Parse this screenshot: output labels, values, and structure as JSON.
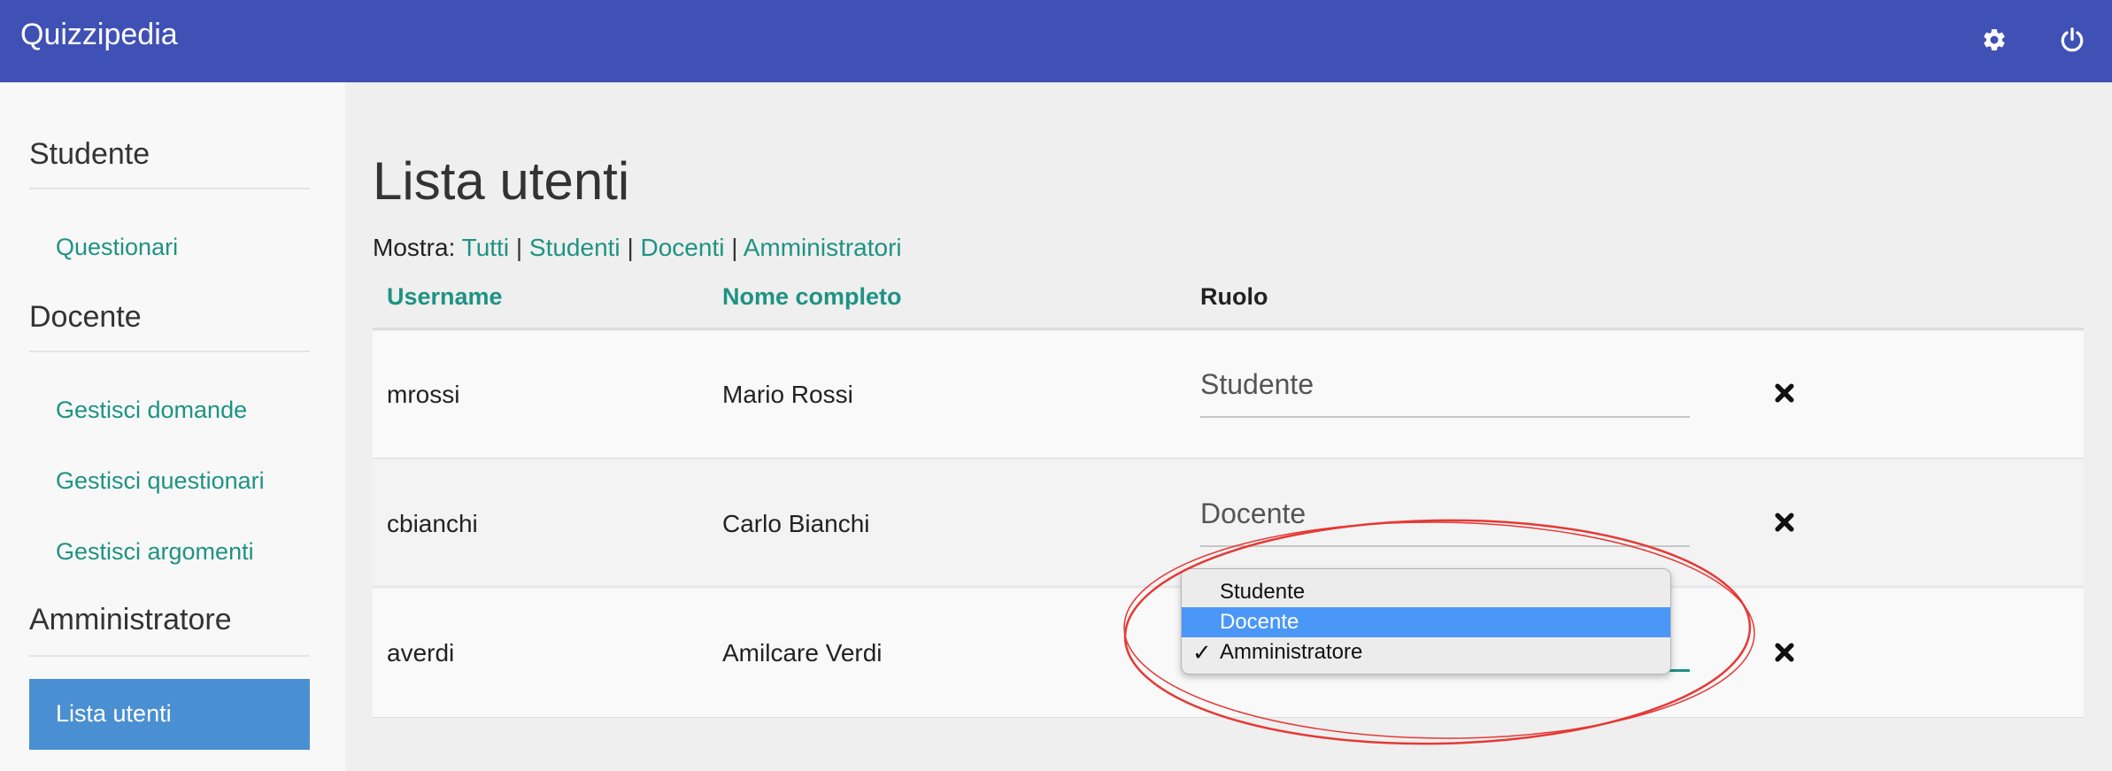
{
  "header": {
    "brand": "Quizzipedia"
  },
  "sidebar": {
    "sections": [
      {
        "title": "Studente",
        "links": [
          "Questionari"
        ]
      },
      {
        "title": "Docente",
        "links": [
          "Gestisci domande",
          "Gestisci questionari",
          "Gestisci argomenti"
        ]
      },
      {
        "title": "Amministratore",
        "links": [
          "Lista utenti"
        ]
      }
    ],
    "active_link": "Lista utenti"
  },
  "main": {
    "title": "Lista utenti",
    "filter": {
      "label": "Mostra:",
      "options": [
        "Tutti",
        "Studenti",
        "Docenti",
        "Amministratori"
      ],
      "separator": "|"
    },
    "table": {
      "columns": [
        "Username",
        "Nome completo",
        "Ruolo"
      ],
      "rows": [
        {
          "username": "mrossi",
          "full_name": "Mario Rossi",
          "role": "Studente"
        },
        {
          "username": "cbianchi",
          "full_name": "Carlo Bianchi",
          "role": "Docente"
        },
        {
          "username": "averdi",
          "full_name": "Amilcare Verdi",
          "role": "Amministratore"
        }
      ]
    }
  },
  "role_dropdown": {
    "options": [
      "Studente",
      "Docente",
      "Amministratore"
    ],
    "highlighted": "Docente",
    "checked": "Amministratore",
    "check_glyph": "✓"
  },
  "icons": {
    "settings": "gear-icon",
    "logout": "power-icon",
    "delete": "close-icon"
  },
  "colors": {
    "header_bg": "#3f51b5",
    "link": "#1e9383",
    "active_nav_bg": "#4a8fd1",
    "dropdown_highlight": "#4b97f8",
    "annotation": "#e53935"
  }
}
